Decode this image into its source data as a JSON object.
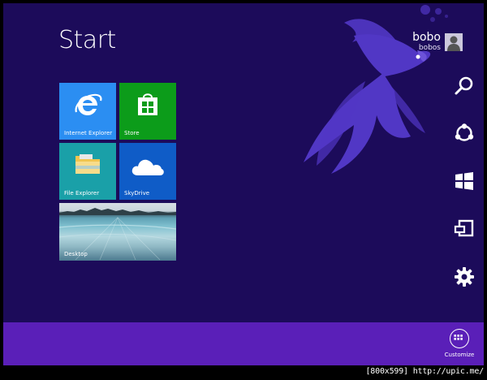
{
  "start": {
    "title": "Start"
  },
  "user": {
    "name": "bobo",
    "account": "bobos"
  },
  "tiles": {
    "internet_explorer": {
      "label": "Internet Explorer",
      "color": "#2b8ef2"
    },
    "store": {
      "label": "Store",
      "color": "#0c9c1a"
    },
    "file_explorer": {
      "label": "File Explorer",
      "color": "#1aa0a8"
    },
    "skydrive": {
      "label": "SkyDrive",
      "color": "#0f5cc7"
    },
    "desktop": {
      "label": "Desktop"
    }
  },
  "charms": [
    "search-icon",
    "share-icon",
    "windows-icon",
    "devices-icon",
    "settings-icon"
  ],
  "app_bar": {
    "customize_label": "Customize"
  },
  "watermark": "[800x599] http://upic.me/",
  "colors": {
    "background": "#1c0b5a",
    "app_bar": "#5a1fb8",
    "fish": "#5b3fd8"
  }
}
